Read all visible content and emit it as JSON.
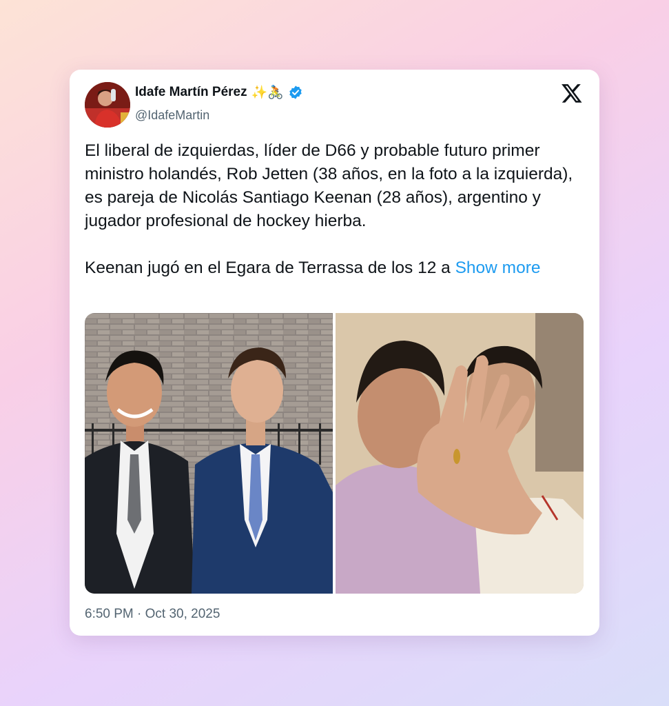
{
  "author": {
    "name": "Idafe Martín Pérez",
    "name_emojis": "✨🚴",
    "handle": "@IdafeMartin",
    "verified": true
  },
  "tweet": {
    "text_main": "El liberal de izquierdas, líder de D66 y probable futuro primer ministro holandés, Rob Jetten (38 años, en la foto a la izquierda), es pareja de Nicolás Santiago Keenan (28 años), argentino y jugador profesional de hockey hierba.\n\nKeenan jugó en el Egara de Terrassa de los 12 a ",
    "show_more_label": "Show more",
    "timestamp": "6:50 PM · Oct 30, 2025"
  },
  "icons": {
    "brand": "x-logo-icon",
    "verified": "verified-badge-icon"
  },
  "colors": {
    "link": "#1d9bf0",
    "verified": "#1d9bf0",
    "secondary_text": "#536471",
    "primary_text": "#0f1419"
  }
}
